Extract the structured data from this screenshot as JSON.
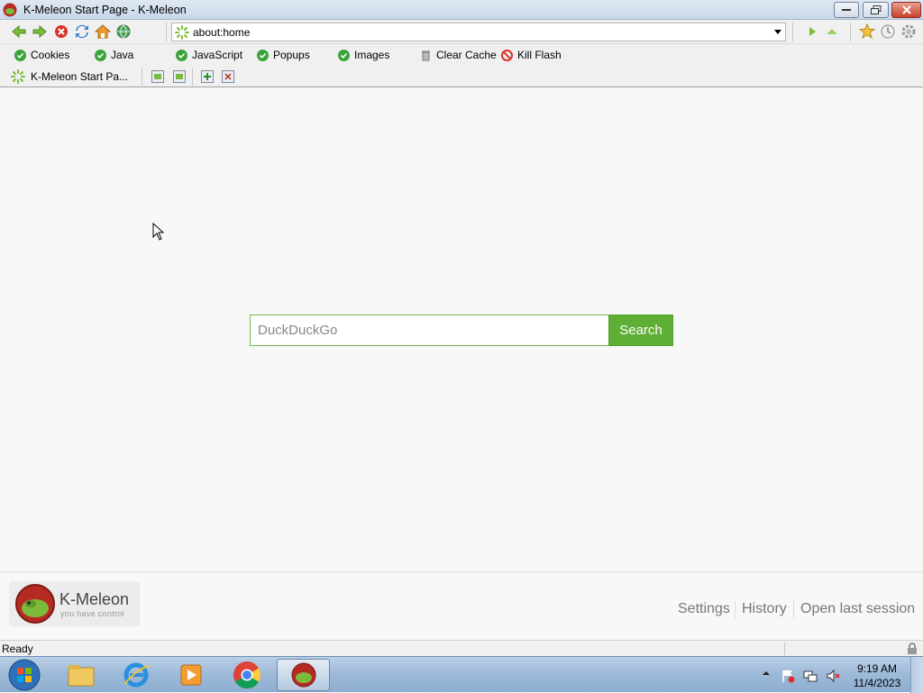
{
  "window": {
    "title": "K-Meleon Start Page - K-Meleon"
  },
  "address_bar": {
    "url": "about:home"
  },
  "privacy_bar": {
    "items": [
      "Cookies",
      "Java",
      "JavaScript",
      "Popups",
      "Images"
    ],
    "clear_cache": "Clear Cache",
    "kill_flash": "Kill Flash"
  },
  "tabs": [
    {
      "label": "K-Meleon Start Pa..."
    }
  ],
  "search": {
    "placeholder": "DuckDuckGo",
    "button_label": "Search"
  },
  "footer": {
    "logo_name": "K-Meleon",
    "logo_tagline": "you have control",
    "links": [
      "Settings",
      "History",
      "Open last session"
    ]
  },
  "status": {
    "text": "Ready"
  },
  "taskbar": {
    "time": "9:19 AM",
    "date": "11/4/2023",
    "apps": [
      "start-orb-icon",
      "file-explorer-icon",
      "internet-explorer-icon",
      "media-player-icon",
      "chrome-icon",
      "k-meleon-icon"
    ]
  },
  "colors": {
    "search_accent": "#5fae36",
    "privacy_check": "#3aa33a"
  }
}
